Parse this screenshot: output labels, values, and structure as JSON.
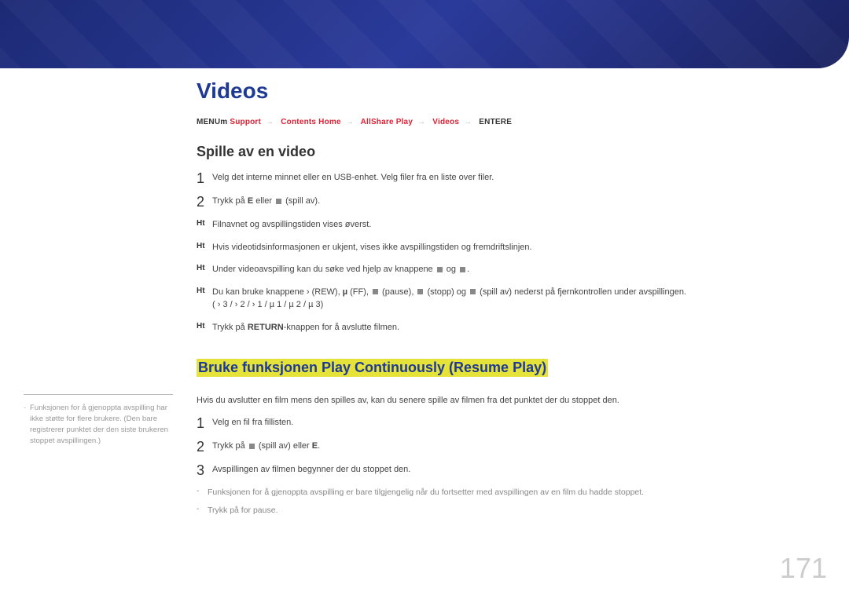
{
  "page_number": "171",
  "title": "Videos",
  "breadcrumb": {
    "p1": "MENU",
    "p1s": "m",
    "p2": "Support",
    "p3": "Contents Home",
    "p4": "AllShare Play",
    "p5": "Videos",
    "p6": "ENTER",
    "p6s": "E"
  },
  "section1": {
    "heading": "Spille av en video",
    "steps": [
      {
        "n": "1",
        "t": "Velg det interne minnet eller en USB-enhet. Velg filer fra en liste over filer."
      },
      {
        "n": "2",
        "t_pre": "Trykk på ",
        "t_b": "E",
        "t_mid": " eller ",
        "t_post": " (spill av)."
      }
    ],
    "hints": [
      {
        "t": "Filnavnet og avspillingstiden vises øverst."
      },
      {
        "t": "Hvis videotidsinformasjonen er ukjent, vises ikke avspillingstiden og fremdriftslinjen."
      },
      {
        "t_pre": "Under videoavspilling kan du søke ved hjelp av knappene ",
        "t_mid": " og ",
        "t_post": "."
      },
      {
        "t_pre": "Du kan bruke knappene ",
        "seq1": "› (REW), ",
        "seq1b": "µ",
        "seq2": " (FF), ",
        "seq3": " (pause), ",
        "seq4": " (stopp) og ",
        "seq5": " (spill av) nederst på fjernkontrollen under avspillingen.",
        "line2": "( ›   3 / ›   2 / ›   1 / µ   1 / µ   2 / µ   3)"
      },
      {
        "t_pre": "Trykk på ",
        "t_b": "RETURN",
        "t_post": "-knappen for å avslutte filmen."
      }
    ]
  },
  "section2": {
    "heading": "Bruke funksjonen Play Continuously (Resume Play)",
    "intro": "Hvis du avslutter en film mens den spilles av, kan du senere spille av filmen fra det punktet der du stoppet den.",
    "steps": [
      {
        "n": "1",
        "t": "Velg en fil fra fillisten."
      },
      {
        "n": "2",
        "t_pre": "Trykk på ",
        "t_mid": " (spill av) eller ",
        "t_b": "E",
        "t_post": "."
      },
      {
        "n": "3",
        "t": "Avspillingen av filmen begynner der du stoppet den."
      }
    ],
    "bullets": [
      "Funksjonen for å gjenoppta avspilling er bare tilgjengelig når du fortsetter med avspillingen av en film du hadde stoppet.",
      "Trykk på    for pause."
    ]
  },
  "sidebar_note": "Funksjonen for å gjenoppta avspilling har ikke støtte for flere brukere. (Den bare registrerer punktet der den siste brukeren stoppet avspillingen.)"
}
